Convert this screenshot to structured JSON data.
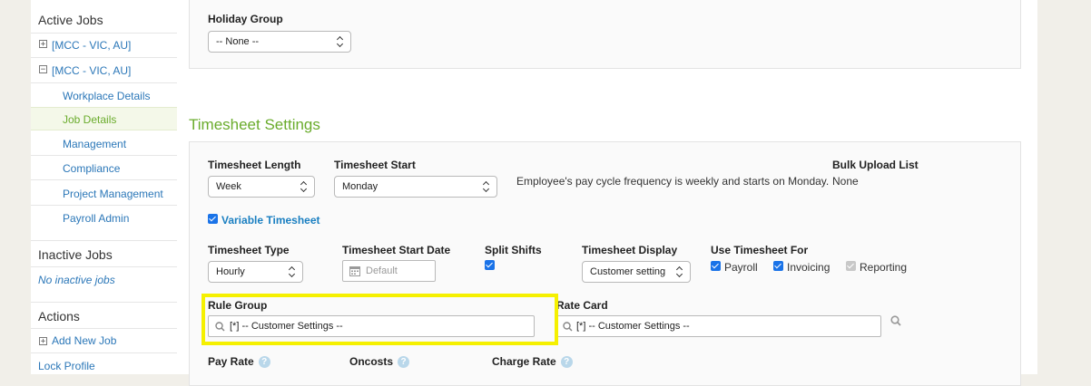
{
  "sidebar": {
    "active_jobs_heading": "Active Jobs",
    "jobs": [
      {
        "expander": "+",
        "label": "[MCC - VIC, AU]"
      },
      {
        "expander": "−",
        "label": "[MCC - VIC, AU]"
      }
    ],
    "sub_items": [
      "Workplace Details",
      "Job Details",
      "Management",
      "Compliance",
      "Project Management",
      "Payroll Admin"
    ],
    "inactive_jobs_heading": "Inactive Jobs",
    "no_inactive_jobs": "No inactive jobs",
    "actions_heading": "Actions",
    "add_new_job": "Add New Job",
    "add_new_job_expander": "+",
    "lock_profile": "Lock Profile"
  },
  "holiday": {
    "label": "Holiday Group",
    "value": "-- None --"
  },
  "timesheet": {
    "section_title": "Timesheet Settings",
    "length_label": "Timesheet Length",
    "length_value": "Week",
    "start_label": "Timesheet Start",
    "start_value": "Monday",
    "cycle_note": "Employee's pay cycle frequency is weekly and starts on Monday.",
    "bulk_upload_label": "Bulk Upload List",
    "bulk_upload_value": "None",
    "variable_label": "Variable Timesheet",
    "type_label": "Timesheet Type",
    "type_value": "Hourly",
    "start_date_label": "Timesheet Start Date",
    "start_date_placeholder": "Default",
    "split_shifts_label": "Split Shifts",
    "display_label": "Timesheet Display",
    "display_value": "Customer setting",
    "use_for_label": "Use Timesheet For",
    "use_for_options": [
      "Payroll",
      "Invoicing",
      "Reporting"
    ],
    "rule_group_label": "Rule Group",
    "rule_group_value": "[*] -- Customer Settings --",
    "rate_card_label": "Rate Card",
    "rate_card_value": "[*] -- Customer Settings --",
    "pay_rate_label": "Pay Rate",
    "oncosts_label": "Oncosts",
    "charge_rate_label": "Charge Rate",
    "help_glyph": "?"
  },
  "colors": {
    "accent_green": "#6aac2c",
    "link_blue": "#2b77b8",
    "highlight_yellow": "#f5f000"
  }
}
